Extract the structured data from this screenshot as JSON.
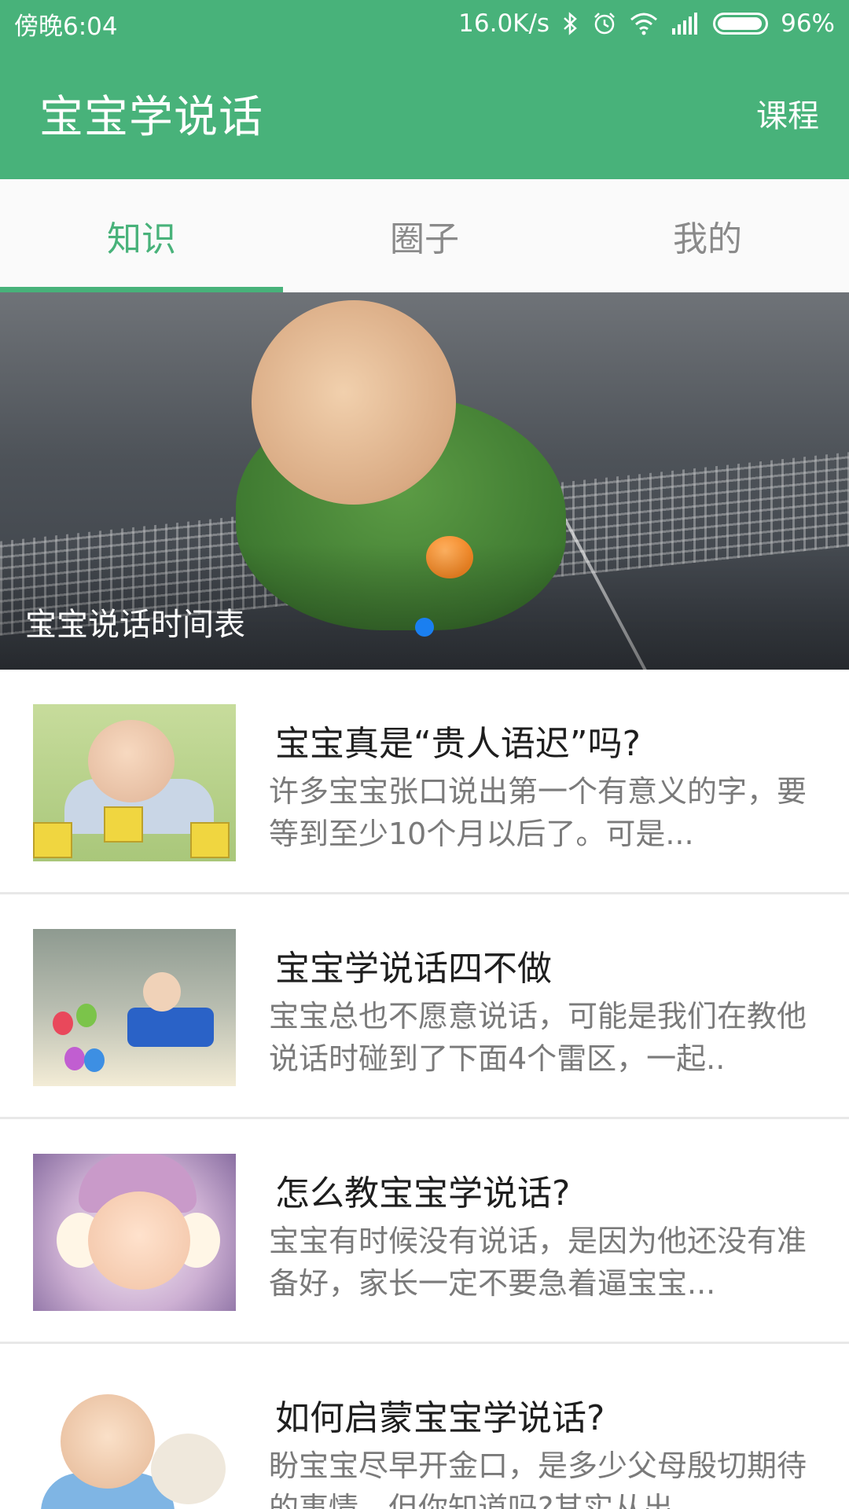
{
  "status_bar": {
    "time": "傍晚6:04",
    "network_speed": "16.0K/s",
    "battery_percent": "96%",
    "battery_level": 0.96,
    "icons": [
      "bluetooth-icon",
      "alarm-icon",
      "wifi-icon",
      "signal-icon",
      "battery-icon"
    ]
  },
  "app_bar": {
    "title": "宝宝学说话",
    "action_label": "课程"
  },
  "tabs": [
    {
      "label": "知识",
      "active": true
    },
    {
      "label": "圈子",
      "active": false
    },
    {
      "label": "我的",
      "active": false
    }
  ],
  "banner": {
    "caption": "宝宝说话时间表",
    "page_indicator_count": 1,
    "active_index": 0
  },
  "articles": [
    {
      "title": "宝宝真是“贵人语迟”吗?",
      "description": "许多宝宝张口说出第一个有意义的字，要等到至少10个月以后了。可是..."
    },
    {
      "title": "宝宝学说话四不做",
      "description": "宝宝总也不愿意说话，可能是我们在教他说话时碰到了下面4个雷区，一起.."
    },
    {
      "title": "怎么教宝宝学说话?",
      "description": "宝宝有时候没有说话，是因为他还没有准备好，家长一定不要急着逼宝宝..."
    },
    {
      "title": "如何启蒙宝宝学说话?",
      "description": "盼宝宝尽早开金口，是多少父母殷切期待的事情，但你知道吗?其实从出"
    }
  ],
  "colors": {
    "primary": "#48b27a",
    "indicator": "#1a7ff0",
    "title_text": "#1e1e1e",
    "desc_text": "#7a7a7a"
  }
}
